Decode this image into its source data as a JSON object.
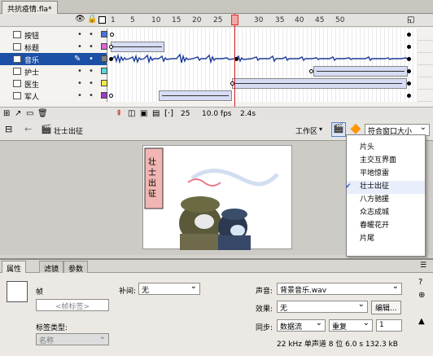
{
  "document": {
    "tab_title": "共抗疫情.fla*"
  },
  "timeline": {
    "ruler": [
      "1",
      "5",
      "10",
      "15",
      "20",
      "25",
      "30",
      "35",
      "40",
      "45",
      "50"
    ],
    "layers": [
      {
        "name": "按钮",
        "color": "#4a74d4"
      },
      {
        "name": "标题",
        "color": "#e065d6"
      },
      {
        "name": "音乐",
        "color": "#808080",
        "selected": true
      },
      {
        "name": "护士",
        "color": "#5bd6d4"
      },
      {
        "name": "医生",
        "color": "#f2ea46"
      },
      {
        "name": "军人",
        "color": "#9c3ac6"
      }
    ],
    "footer": {
      "current_frame": "25",
      "fps": "10.0 fps",
      "elapsed": "2.4s"
    }
  },
  "editbar": {
    "scene": "壮士出征",
    "workspace": "工作区",
    "zoom": "符合窗口大小"
  },
  "stage": {
    "banner_text": "壮士出征"
  },
  "scene_menu": {
    "items": [
      "片头",
      "主交互界面",
      "平地惊雷",
      "壮士出征",
      "八方驰援",
      "众志成城",
      "春暖花开",
      "片尾"
    ],
    "checked_index": 3
  },
  "properties": {
    "tabs": [
      "属性",
      "滤镜",
      "参数"
    ],
    "frame_label": "帧",
    "frame_name_placeholder": "<帧标签>",
    "label_type_label": "标签类型:",
    "label_type_value": "名称",
    "tween_label": "补间:",
    "tween_value": "无",
    "sound_label": "声音:",
    "sound_value": "背景音乐.wav",
    "effect_label": "效果:",
    "effect_value": "无",
    "edit_button": "编辑...",
    "sync_label": "同步:",
    "sync_value": "数据流",
    "repeat_value": "重复",
    "repeat_count": "1",
    "sound_info": "22 kHz 单声道 8 位 6.0 s 132.3 kB"
  }
}
